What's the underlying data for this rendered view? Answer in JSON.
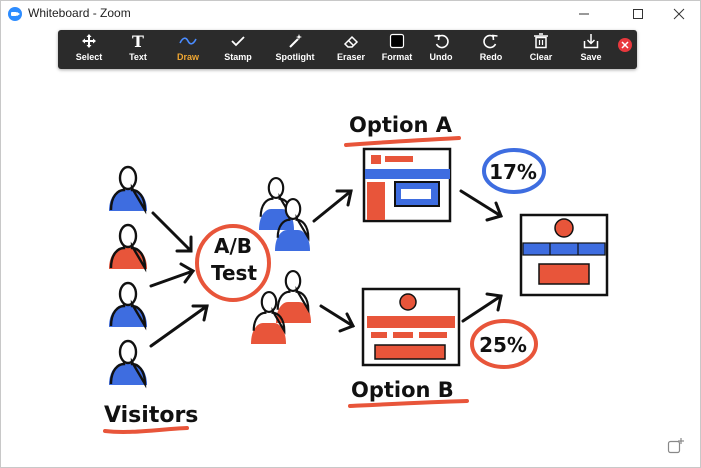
{
  "window": {
    "title": "Whiteboard - Zoom"
  },
  "toolbar": {
    "select": "Select",
    "text": "Text",
    "draw": "Draw",
    "stamp": "Stamp",
    "spotlight": "Spotlight",
    "eraser": "Eraser",
    "format": "Format",
    "undo": "Undo",
    "redo": "Redo",
    "clear": "Clear",
    "save": "Save",
    "active_tool": "Draw"
  },
  "whiteboard": {
    "option_a": "Option A",
    "option_b": "Option B",
    "test_line1": "A/B",
    "test_line2": "Test",
    "visitors": "Visitors",
    "pct_a": "17%",
    "pct_b": "25%"
  },
  "colors": {
    "blue": "#3e6de0",
    "red": "#e8553a",
    "ink": "#111111",
    "toolbar": "#2b2b2b",
    "active": "#f0a732"
  }
}
